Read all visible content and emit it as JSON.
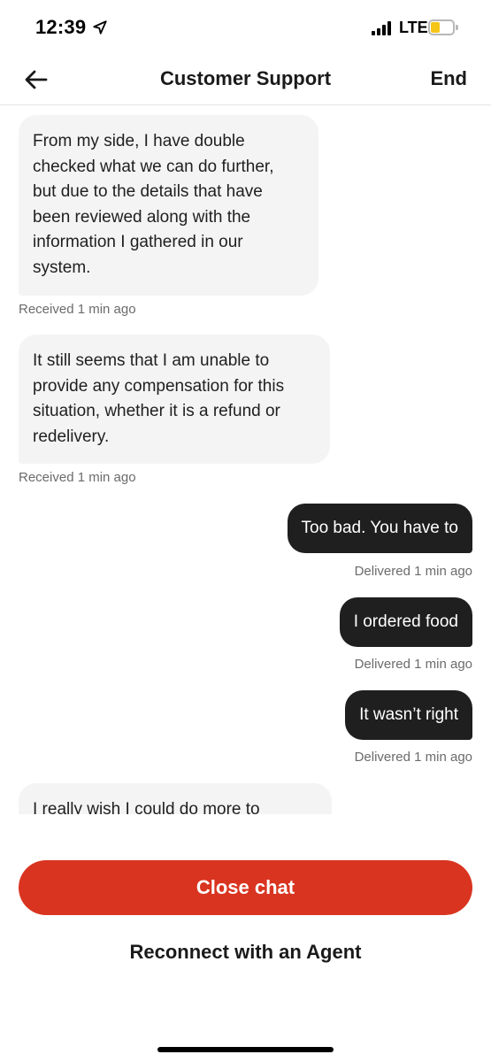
{
  "status_bar": {
    "time": "12:39",
    "network": "LTE",
    "battery_level": 0.4,
    "icons": [
      "location-arrow-icon",
      "signal-bars-icon",
      "battery-icon"
    ],
    "battery_color": "#f5c518"
  },
  "nav": {
    "back_icon": "arrow-left-icon",
    "title": "Customer Support",
    "end_label": "End"
  },
  "messages": [
    {
      "direction": "incoming",
      "lines": [
        "From my side, I have double",
        "checked what we can do further,",
        "but due to the details that have",
        "been reviewed along with the",
        "information I gathered in our",
        "system."
      ],
      "status": "Received 1 min ago"
    },
    {
      "direction": "incoming",
      "lines": [
        "It still seems that I am unable to",
        "provide any compensation for this",
        "situation, whether it is a refund or",
        "redelivery."
      ],
      "status": "Received 1 min ago"
    },
    {
      "direction": "outgoing",
      "text": "Too bad. You have to",
      "status": "Delivered 1 min ago"
    },
    {
      "direction": "outgoing",
      "text": "I ordered food",
      "status": "Delivered 1 min ago"
    },
    {
      "direction": "outgoing",
      "text": "It wasn’t right",
      "status": "Delivered 1 min ago"
    },
    {
      "direction": "incoming",
      "lines": [
        "I really wish I could do more to"
      ],
      "status": ""
    }
  ],
  "actions": {
    "close_chat_label": "Close chat",
    "reconnect_label": "Reconnect with an Agent"
  },
  "colors": {
    "accent": "#d93420",
    "outgoing_bubble": "#1f1f1f",
    "incoming_bubble": "#f4f4f4",
    "meta_text": "#6b6b6b"
  }
}
